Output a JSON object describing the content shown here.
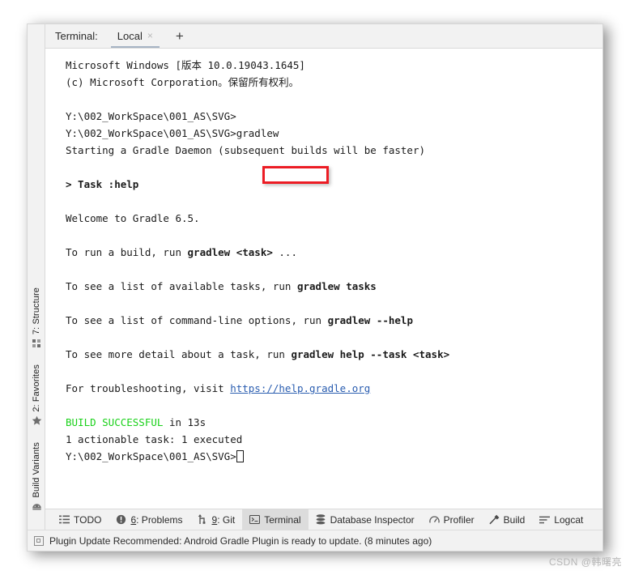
{
  "window": {
    "grip_dots": 2
  },
  "left_strip": {
    "items": [
      {
        "label": "7: Structure",
        "icon": "structure-icon"
      },
      {
        "label": "2: Favorites",
        "icon": "star-icon"
      },
      {
        "label": "Build Variants",
        "icon": "android-icon"
      }
    ]
  },
  "terminal": {
    "title": "Terminal:",
    "tab": {
      "label": "Local",
      "close": "×"
    },
    "add_tab": "+",
    "lines": [
      {
        "segments": [
          {
            "text": "Microsoft Windows [版本 10.0.19043.1645]"
          }
        ]
      },
      {
        "segments": [
          {
            "text": "(c) Microsoft Corporation。保留所有权利。"
          }
        ]
      },
      {
        "segments": [
          {
            "text": ""
          }
        ]
      },
      {
        "segments": [
          {
            "text": "Y:\\002_WorkSpace\\001_AS\\SVG>"
          }
        ]
      },
      {
        "segments": [
          {
            "text": "Y:\\002_WorkSpace\\001_AS\\SVG>gradlew"
          }
        ]
      },
      {
        "segments": [
          {
            "text": "Starting a Gradle Daemon (subsequent builds will be faster)"
          }
        ]
      },
      {
        "segments": [
          {
            "text": ""
          }
        ]
      },
      {
        "segments": [
          {
            "text": "> Task :help",
            "style": "b"
          }
        ]
      },
      {
        "segments": [
          {
            "text": ""
          }
        ]
      },
      {
        "segments": [
          {
            "text": "Welcome to Gradle 6.5."
          }
        ]
      },
      {
        "segments": [
          {
            "text": ""
          }
        ]
      },
      {
        "segments": [
          {
            "text": "To run a build, run "
          },
          {
            "text": "gradlew <task>",
            "style": "b"
          },
          {
            "text": " ..."
          }
        ]
      },
      {
        "segments": [
          {
            "text": ""
          }
        ]
      },
      {
        "segments": [
          {
            "text": "To see a list of available tasks, run "
          },
          {
            "text": "gradlew tasks",
            "style": "b"
          }
        ]
      },
      {
        "segments": [
          {
            "text": ""
          }
        ]
      },
      {
        "segments": [
          {
            "text": "To see a list of command-line options, run "
          },
          {
            "text": "gradlew --help",
            "style": "b"
          }
        ]
      },
      {
        "segments": [
          {
            "text": ""
          }
        ]
      },
      {
        "segments": [
          {
            "text": "To see more detail about a task, run "
          },
          {
            "text": "gradlew help --task <task>",
            "style": "b"
          }
        ]
      },
      {
        "segments": [
          {
            "text": ""
          }
        ]
      },
      {
        "segments": [
          {
            "text": "For troubleshooting, visit "
          },
          {
            "text": "https://help.gradle.org",
            "style": "link"
          }
        ]
      },
      {
        "segments": [
          {
            "text": ""
          }
        ]
      },
      {
        "segments": [
          {
            "text": "BUILD SUCCESSFUL",
            "style": "green"
          },
          {
            "text": " in 13s"
          }
        ]
      },
      {
        "segments": [
          {
            "text": "1 actionable task: 1 executed"
          }
        ]
      },
      {
        "segments": [
          {
            "text": "Y:\\002_WorkSpace\\001_AS\\SVG>"
          },
          {
            "text": "",
            "style": "cursor"
          }
        ]
      }
    ],
    "annotation": {
      "type": "red-rectangle",
      "target_text": ">gradlew",
      "color": "#ec1c24"
    }
  },
  "toolwindow_bar": {
    "items": [
      {
        "label": "TODO",
        "icon": "list-icon",
        "selected": false,
        "mnemonic": ""
      },
      {
        "label": "Problems",
        "icon": "warning-icon",
        "selected": false,
        "mnemonic": "6"
      },
      {
        "label": "Git",
        "icon": "branch-icon",
        "selected": false,
        "mnemonic": "9"
      },
      {
        "label": "Terminal",
        "icon": "console-icon",
        "selected": true,
        "mnemonic": ""
      },
      {
        "label": "Database Inspector",
        "icon": "database-icon",
        "selected": false,
        "mnemonic": ""
      },
      {
        "label": "Profiler",
        "icon": "gauge-icon",
        "selected": false,
        "mnemonic": ""
      },
      {
        "label": "Build",
        "icon": "hammer-icon",
        "selected": false,
        "mnemonic": ""
      },
      {
        "label": "Logcat",
        "icon": "lines-icon",
        "selected": false,
        "mnemonic": ""
      }
    ]
  },
  "status_bar": {
    "icon": "notification-icon",
    "message": "Plugin Update Recommended: Android Gradle Plugin is ready to update. (8 minutes ago)"
  },
  "watermark": {
    "text": "CSDN @韩曙亮"
  },
  "colors": {
    "accent_red": "#ec1c24",
    "link_blue": "#2a5db0",
    "success_green": "#1ad11a",
    "panel_bg": "#f2f2f2",
    "terminal_bg": "#ffffff"
  }
}
